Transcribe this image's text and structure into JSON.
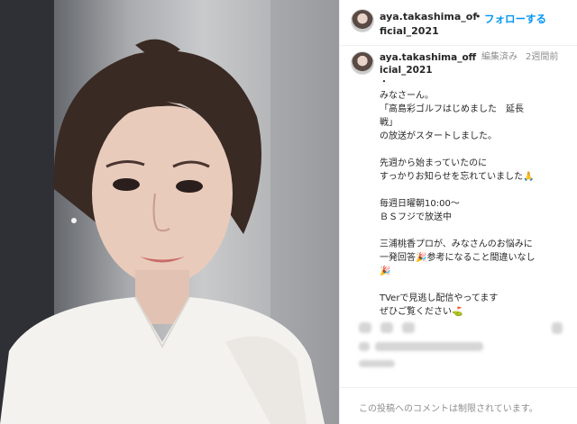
{
  "header": {
    "username": "aya.takashima_official_2021",
    "separator": "•",
    "follow_label": "フォローする"
  },
  "caption_block": {
    "username": "aya.takashima_official_2021",
    "edited_label": "編集済み",
    "time_label": "2週間前"
  },
  "caption_lines": [
    "・",
    "みなさーん。",
    "「高島彩ゴルフはじめました　延長",
    "戦」",
    "の放送がスタートしました。",
    "",
    "先週から始まっていたのに",
    "すっかりお知らせを忘れていました🙏",
    "",
    "毎週日曜朝10:00〜",
    "ＢＳフジで放送中",
    "",
    "三浦桃香プロが、みなさんのお悩みに",
    "一発回答🎉参考になること間違いなし",
    "🎉",
    "",
    "TVerで見逃し配信やってます",
    "ぜひご覧ください⛳"
  ],
  "footer": {
    "comments_disabled": "この投稿へのコメントは制限されています。"
  },
  "icons": [
    "avatar-icon",
    "heart-icon",
    "comment-icon",
    "share-icon",
    "bookmark-icon"
  ]
}
